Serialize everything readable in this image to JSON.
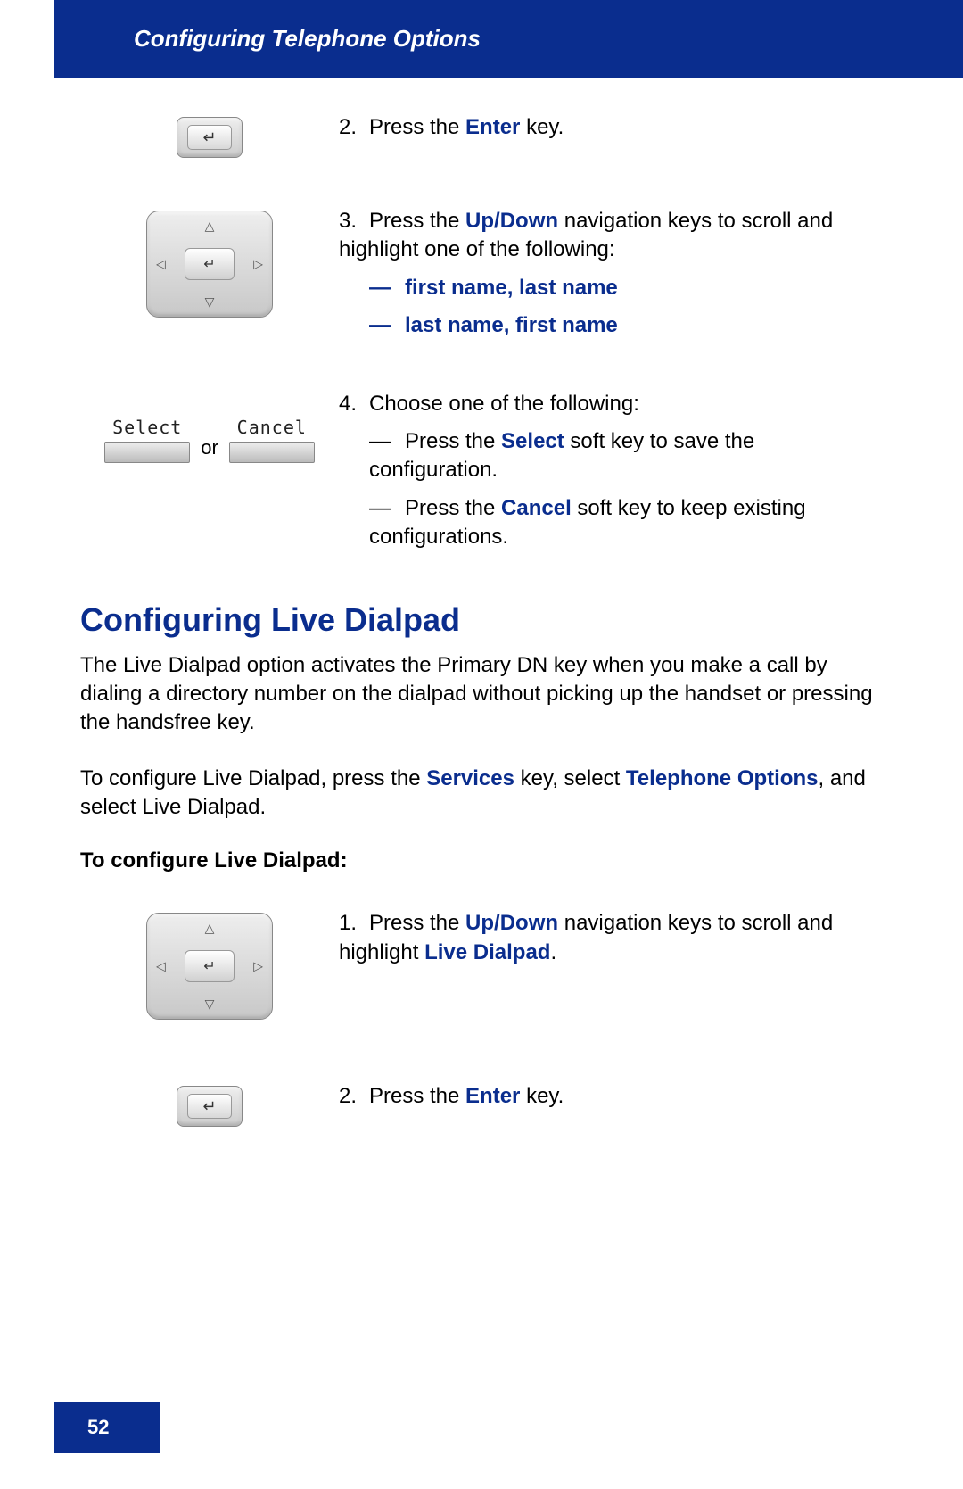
{
  "header": {
    "title": "Configuring Telephone Options"
  },
  "steps_top": {
    "s2": {
      "num": "2.",
      "pre": "Press the ",
      "key": "Enter",
      "post": " key."
    },
    "s3": {
      "num": "3.",
      "pre": "Press the ",
      "key1": "Up",
      "slash": "/",
      "key2": "Down",
      "post": " navigation keys to scroll and highlight one of the following:",
      "opt1_dash": "—",
      "opt1": "first name, last name",
      "opt2_dash": "—",
      "opt2": "last name, first name"
    },
    "s4": {
      "num": "4.",
      "intro": "Choose one of the following:",
      "a_dash": "—",
      "a_pre": "Press the ",
      "a_key": "Select",
      "a_post": " soft key to save the configuration.",
      "b_dash": "—",
      "b_pre": "Press the ",
      "b_key": "Cancel",
      "b_post": " soft key to keep existing configurations."
    }
  },
  "softkeys": {
    "select": "Select",
    "cancel": "Cancel",
    "or": "or"
  },
  "section": {
    "heading": "Configuring Live Dialpad",
    "para1": "The Live Dialpad option activates the Primary DN key when you make a call by dialing a directory number on the dialpad without picking up the handset or pressing the handsfree key.",
    "para2_pre": "To configure Live Dialpad, press the ",
    "para2_k1": "Services",
    "para2_mid": " key, select ",
    "para2_k2": "Telephone Options",
    "para2_post": ", and select Live Dialpad.",
    "subheading": "To configure Live Dialpad:"
  },
  "steps_bottom": {
    "s1": {
      "num": "1.",
      "pre": "Press the ",
      "key1": "Up",
      "slash": "/",
      "key2": "Down",
      "post1": " navigation keys to scroll and highlight ",
      "target": "Live Dialpad",
      "post2": "."
    },
    "s2": {
      "num": "2.",
      "pre": "Press the ",
      "key": "Enter",
      "post": " key."
    }
  },
  "footer": {
    "page": "52"
  }
}
